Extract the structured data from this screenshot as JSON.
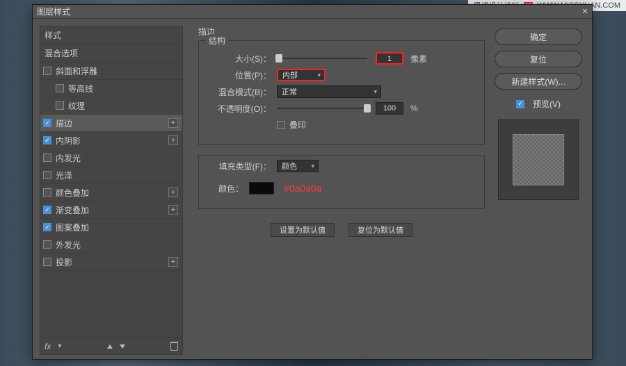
{
  "watermark": {
    "text": "思缘设计论坛",
    "url": "WWW.MISSYUAN.COM"
  },
  "dialog": {
    "title": "图层样式"
  },
  "left": {
    "styles_header": "样式",
    "blend_header": "混合选项",
    "items": [
      {
        "label": "斜面和浮雕",
        "checked": false,
        "selected": false,
        "indent": false,
        "plus": false
      },
      {
        "label": "等高线",
        "checked": false,
        "selected": false,
        "indent": true,
        "plus": false
      },
      {
        "label": "纹理",
        "checked": false,
        "selected": false,
        "indent": true,
        "plus": false
      },
      {
        "label": "描边",
        "checked": true,
        "selected": true,
        "indent": false,
        "plus": true
      },
      {
        "label": "内阴影",
        "checked": true,
        "selected": false,
        "indent": false,
        "plus": true
      },
      {
        "label": "内发光",
        "checked": false,
        "selected": false,
        "indent": false,
        "plus": false
      },
      {
        "label": "光泽",
        "checked": false,
        "selected": false,
        "indent": false,
        "plus": false
      },
      {
        "label": "颜色叠加",
        "checked": false,
        "selected": false,
        "indent": false,
        "plus": true
      },
      {
        "label": "渐变叠加",
        "checked": true,
        "selected": false,
        "indent": false,
        "plus": true
      },
      {
        "label": "图案叠加",
        "checked": true,
        "selected": false,
        "indent": false,
        "plus": false
      },
      {
        "label": "外发光",
        "checked": false,
        "selected": false,
        "indent": false,
        "plus": false
      },
      {
        "label": "投影",
        "checked": false,
        "selected": false,
        "indent": false,
        "plus": true
      }
    ],
    "fx": "fx"
  },
  "center": {
    "panel_title": "描边",
    "struct_title": "结构",
    "size_label": "大小(S)：",
    "size_value": "1",
    "size_unit": "像素",
    "position_label": "位置(P)：",
    "position_value": "内部",
    "blend_label": "混合模式(B)：",
    "blend_value": "正常",
    "opacity_label": "不透明度(O)：",
    "opacity_value": "100",
    "opacity_unit": "%",
    "overprint_label": "叠印",
    "fill_title": "",
    "filltype_label": "填充类型(F)：",
    "filltype_value": "颜色",
    "color_label": "颜色：",
    "hex": "#0a0a0a",
    "default_btn": "设置为默认值",
    "reset_btn": "复位为默认值"
  },
  "right": {
    "ok": "确定",
    "cancel": "复位",
    "newstyle": "新建样式(W)...",
    "preview": "预览(V)"
  }
}
